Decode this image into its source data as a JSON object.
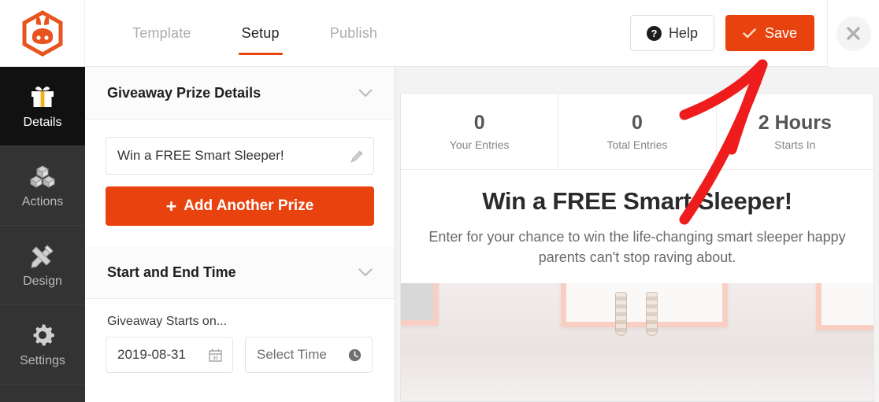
{
  "brand": {
    "logo_icon": "rabbit-hexagon-logo",
    "accent_color": "#e8430e"
  },
  "header": {
    "tabs": [
      {
        "label": "Template",
        "active": false
      },
      {
        "label": "Setup",
        "active": true
      },
      {
        "label": "Publish",
        "active": false
      }
    ],
    "help_button": {
      "label": "Help",
      "icon": "question-mark-icon"
    },
    "save_button": {
      "label": "Save",
      "icon": "check-icon"
    },
    "close_button": {
      "icon": "close-icon"
    }
  },
  "sidebar": {
    "items": [
      {
        "label": "Details",
        "icon": "gift-icon",
        "active": true
      },
      {
        "label": "Actions",
        "icon": "cubes-icon",
        "active": false
      },
      {
        "label": "Design",
        "icon": "pencil-ruler-icon",
        "active": false
      },
      {
        "label": "Settings",
        "icon": "gear-icon",
        "active": false
      }
    ]
  },
  "panel": {
    "prize_section": {
      "title": "Giveaway Prize Details",
      "chevron_icon": "chevron-down-icon",
      "prize_value": "Win a FREE Smart Sleeper!",
      "prize_edit_icon": "pencil-icon",
      "add_prize_label": "Add Another Prize",
      "add_prize_icon": "plus-icon"
    },
    "time_section": {
      "title": "Start and End Time",
      "chevron_icon": "chevron-down-icon",
      "starts_on_label": "Giveaway Starts on...",
      "date_value": "2019-08-31",
      "date_icon": "calendar-icon",
      "time_placeholder": "Select Time",
      "time_icon": "clock-icon"
    }
  },
  "preview": {
    "stats": [
      {
        "value": "0",
        "label": "Your Entries"
      },
      {
        "value": "0",
        "label": "Total Entries"
      },
      {
        "value": "2 Hours",
        "label": "Starts In"
      }
    ],
    "title": "Win a FREE Smart Sleeper!",
    "description": "Enter for your chance to win the life-changing smart sleeper happy parents can't stop raving about."
  },
  "annotation": {
    "shape": "red-arrow-pointing-to-save-button",
    "color": "#ee1c1c"
  }
}
